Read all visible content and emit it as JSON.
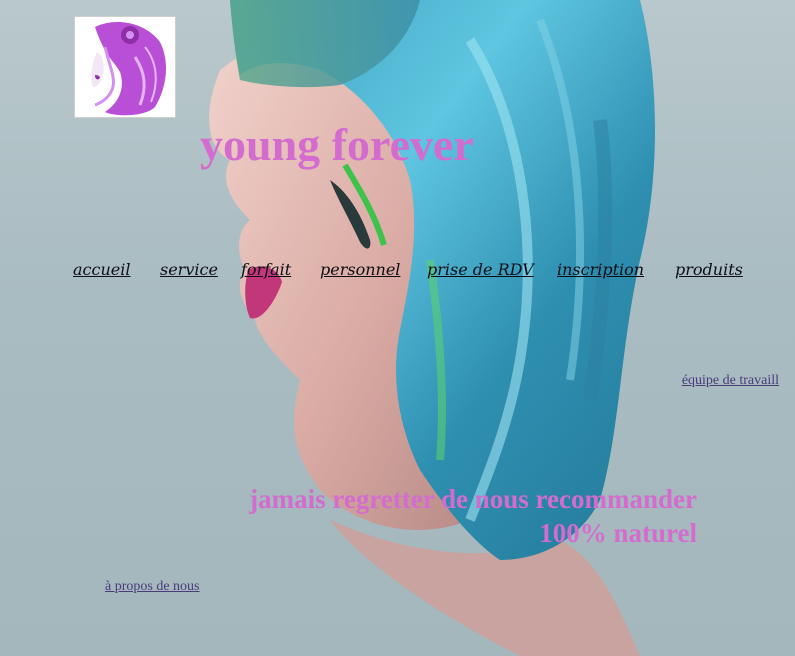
{
  "header": {
    "logo_icon": "woman-profile-logo-icon",
    "title": "young forever"
  },
  "nav": {
    "items": [
      {
        "label": "accueil"
      },
      {
        "label": "service"
      },
      {
        "label": "forfait"
      },
      {
        "label": "personnel"
      },
      {
        "label": "prise de RDV"
      },
      {
        "label": "inscription"
      },
      {
        "label": "produits"
      }
    ]
  },
  "links": {
    "team": "équipe de travaill",
    "about": "à propos de nous"
  },
  "tagline": {
    "line1": "jamais regretter de nous recommander",
    "line2": "100% naturel"
  },
  "colors": {
    "accent": "#d36cce",
    "link": "#4a3b7a",
    "nav_text": "#0e0e14"
  }
}
